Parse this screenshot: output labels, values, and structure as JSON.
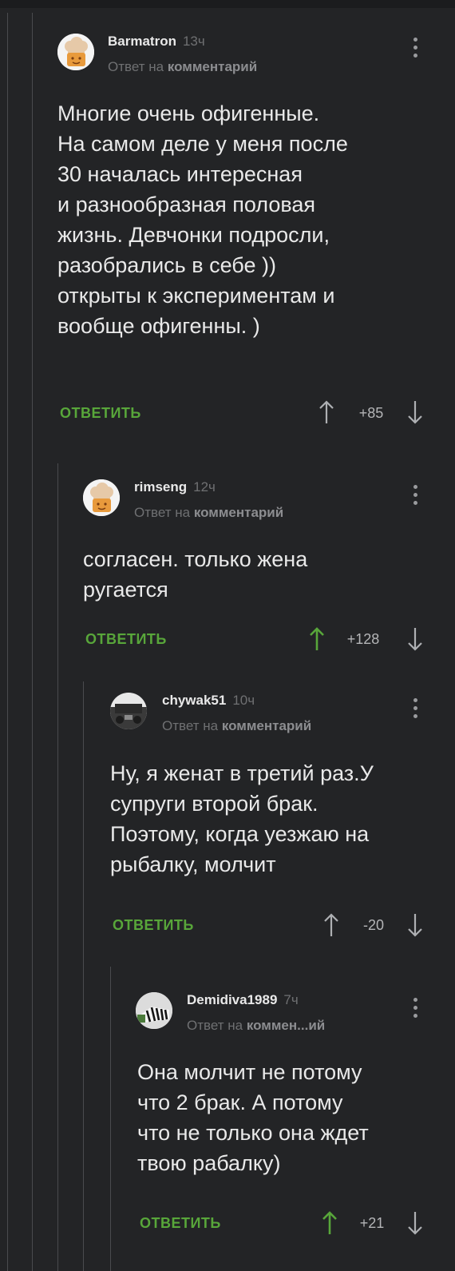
{
  "comments": [
    {
      "author": "Barmatron",
      "time": "13ч",
      "reply_prefix": "Ответ на",
      "reply_target": "комментарий",
      "text": [
        "Многие очень офигенные.",
        "На самом деле у меня после",
        "30 началась интересная",
        "и разнообразная половая",
        "жизнь. Девчонки подросли,",
        "разобрались в себе ))",
        "открыты к экспериментам и",
        "вообще офигенны. )"
      ],
      "reply_label": "ОТВЕТИТЬ",
      "rating": "+85",
      "upvoted": false
    },
    {
      "author": "rimseng",
      "time": "12ч",
      "reply_prefix": "Ответ на",
      "reply_target": "комментарий",
      "text": [
        "согласен. только жена",
        "ругается"
      ],
      "reply_label": "ОТВЕТИТЬ",
      "rating": "+128",
      "upvoted": true
    },
    {
      "author": "chywak51",
      "time": "10ч",
      "reply_prefix": "Ответ на",
      "reply_target": "комментарий",
      "text": [
        "Ну, я женат в третий раз.У",
        "супруги второй брак.",
        "Поэтому, когда уезжаю на",
        "рыбалку, молчит"
      ],
      "reply_label": "ОТВЕТИТЬ",
      "rating": "-20",
      "upvoted": false
    },
    {
      "author": "Demidiva1989",
      "time": "7ч",
      "reply_prefix": "Ответ на",
      "reply_target": "коммен...ий",
      "text": [
        "Она молчит не потому",
        "что 2 брак. А потому",
        "что не только она ждет",
        "твою рабалку)"
      ],
      "reply_label": "ОТВЕТИТЬ",
      "rating": "+21",
      "upvoted": true
    }
  ],
  "colors": {
    "background": "#232426",
    "accent_green": "#58a63a",
    "muted": "#6f7072"
  }
}
